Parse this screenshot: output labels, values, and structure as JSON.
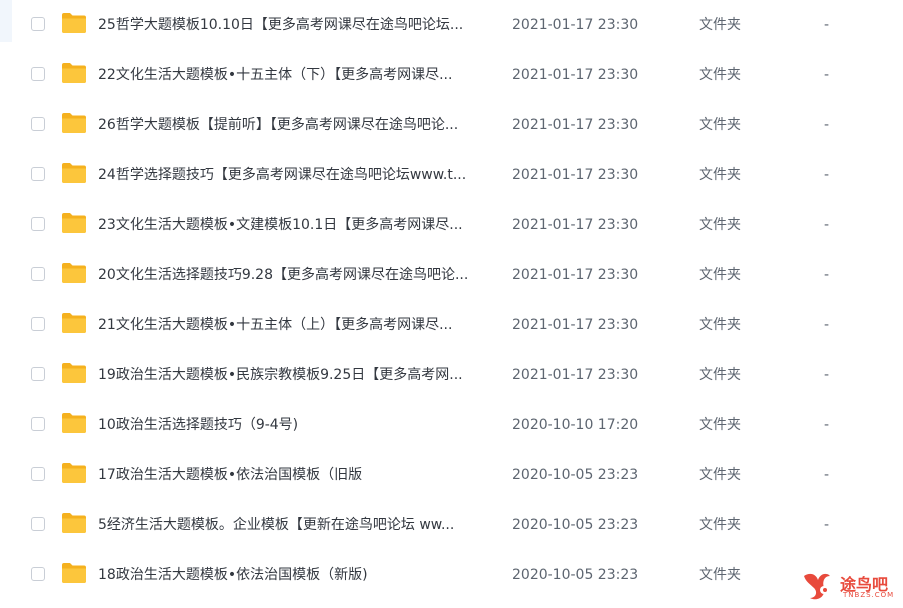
{
  "file_list": {
    "rows": [
      {
        "name": "25哲学大题模板10.10日【更多高考网课尽在途鸟吧论坛...",
        "date": "2021-01-17 23:30",
        "type": "文件夹",
        "size": "-"
      },
      {
        "name": "22文化生活大题模板•十五主体（下）【更多高考网课尽...",
        "date": "2021-01-17 23:30",
        "type": "文件夹",
        "size": "-"
      },
      {
        "name": "26哲学大题模板【提前听】【更多高考网课尽在途鸟吧论...",
        "date": "2021-01-17 23:30",
        "type": "文件夹",
        "size": "-"
      },
      {
        "name": "24哲学选择题技巧【更多高考网课尽在途鸟吧论坛www.t...",
        "date": "2021-01-17 23:30",
        "type": "文件夹",
        "size": "-"
      },
      {
        "name": "23文化生活大题模板•文建模板10.1日【更多高考网课尽...",
        "date": "2021-01-17 23:30",
        "type": "文件夹",
        "size": "-"
      },
      {
        "name": "20文化生活选择题技巧9.28【更多高考网课尽在途鸟吧论...",
        "date": "2021-01-17 23:30",
        "type": "文件夹",
        "size": "-"
      },
      {
        "name": "21文化生活大题模板•十五主体（上）【更多高考网课尽...",
        "date": "2021-01-17 23:30",
        "type": "文件夹",
        "size": "-"
      },
      {
        "name": "19政治生活大题模板•民族宗教模板9.25日【更多高考网...",
        "date": "2021-01-17 23:30",
        "type": "文件夹",
        "size": "-"
      },
      {
        "name": "10政治生活选择题技巧（9-4号)",
        "date": "2020-10-10 17:20",
        "type": "文件夹",
        "size": "-"
      },
      {
        "name": "17政治生活大题模板•依法治国模板（旧版",
        "date": "2020-10-05 23:23",
        "type": "文件夹",
        "size": "-"
      },
      {
        "name": "5经济生活大题模板。企业模板【更新在途鸟吧论坛 ww...",
        "date": "2020-10-05 23:23",
        "type": "文件夹",
        "size": "-"
      },
      {
        "name": "18政治生活大题模板•依法治国模板（新版)",
        "date": "2020-10-05 23:23",
        "type": "文件夹",
        "size": "-"
      }
    ]
  },
  "icons": {
    "row_icon": "folder-icon",
    "checkbox": "checkbox-icon"
  },
  "colors": {
    "folder": "#fcc63c",
    "folder_back": "#f5b11e",
    "text": "#333840",
    "muted_text": "#5d6570",
    "watermark": "#e84a3c"
  },
  "watermark": {
    "text": "途鸟吧",
    "sub": "TNBZS.COM"
  }
}
